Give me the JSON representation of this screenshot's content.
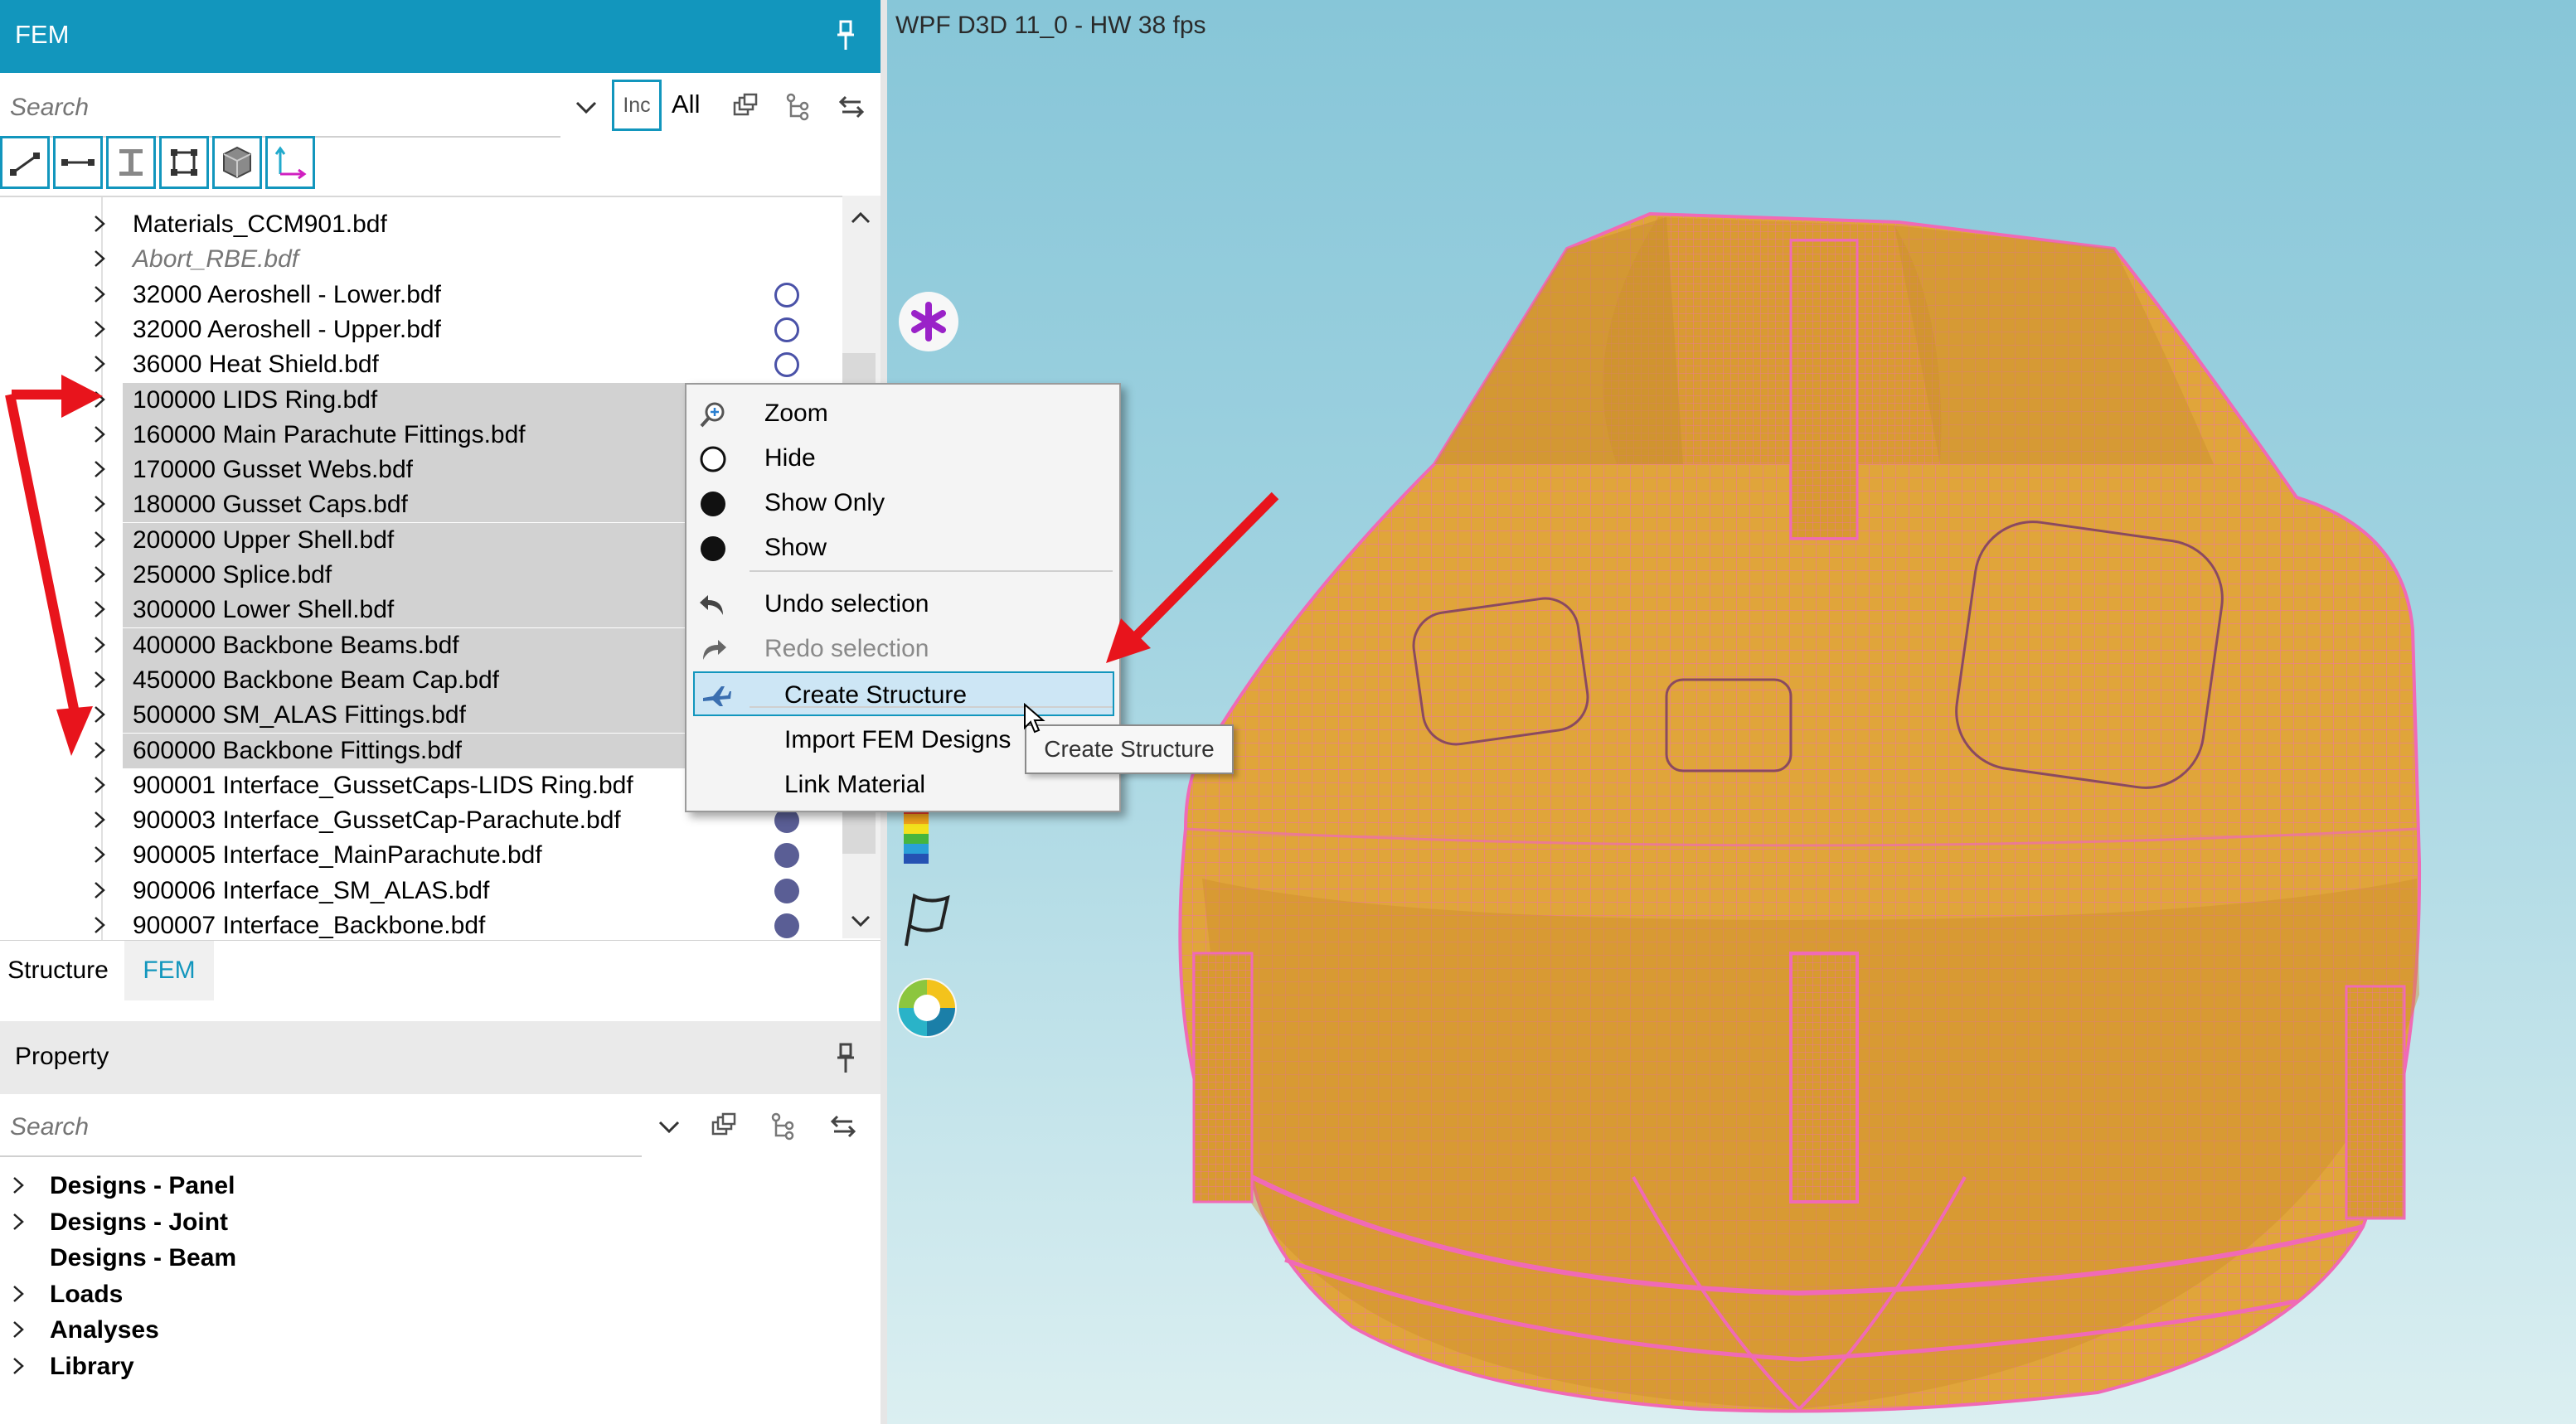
{
  "fem_panel": {
    "title": "FEM",
    "search": {
      "placeholder": "Search",
      "inc_label": "Inc",
      "all_label": "All"
    },
    "tree_items": [
      {
        "label": "Materials_CCM901.bdf",
        "italic": false,
        "selected": false,
        "indicator": "none"
      },
      {
        "label": "Abort_RBE.bdf",
        "italic": true,
        "selected": false,
        "indicator": "none"
      },
      {
        "label": "32000 Aeroshell - Lower.bdf",
        "italic": false,
        "selected": false,
        "indicator": "empty"
      },
      {
        "label": "32000 Aeroshell - Upper.bdf",
        "italic": false,
        "selected": false,
        "indicator": "empty"
      },
      {
        "label": "36000 Heat Shield.bdf",
        "italic": false,
        "selected": false,
        "indicator": "empty"
      },
      {
        "label": "100000 LIDS Ring.bdf",
        "italic": false,
        "selected": true,
        "indicator": "none"
      },
      {
        "label": "160000 Main Parachute Fittings.bdf",
        "italic": false,
        "selected": true,
        "indicator": "none"
      },
      {
        "label": "170000 Gusset Webs.bdf",
        "italic": false,
        "selected": true,
        "indicator": "none"
      },
      {
        "label": "180000 Gusset Caps.bdf",
        "italic": false,
        "selected": true,
        "indicator": "none"
      },
      {
        "label": "200000 Upper Shell.bdf",
        "italic": false,
        "selected": true,
        "indicator": "none"
      },
      {
        "label": "250000 Splice.bdf",
        "italic": false,
        "selected": true,
        "indicator": "none"
      },
      {
        "label": "300000 Lower Shell.bdf",
        "italic": false,
        "selected": true,
        "indicator": "none"
      },
      {
        "label": "400000 Backbone Beams.bdf",
        "italic": false,
        "selected": true,
        "indicator": "none"
      },
      {
        "label": "450000 Backbone Beam Cap.bdf",
        "italic": false,
        "selected": true,
        "indicator": "none"
      },
      {
        "label": "500000 SM_ALAS Fittings.bdf",
        "italic": false,
        "selected": true,
        "indicator": "none"
      },
      {
        "label": "600000 Backbone Fittings.bdf",
        "italic": false,
        "selected": true,
        "indicator": "none"
      },
      {
        "label": "900001 Interface_GussetCaps-LIDS Ring.bdf",
        "italic": false,
        "selected": false,
        "indicator": "full"
      },
      {
        "label": "900003 Interface_GussetCap-Parachute.bdf",
        "italic": false,
        "selected": false,
        "indicator": "full"
      },
      {
        "label": "900005 Interface_MainParachute.bdf",
        "italic": false,
        "selected": false,
        "indicator": "full"
      },
      {
        "label": "900006 Interface_SM_ALAS.bdf",
        "italic": false,
        "selected": false,
        "indicator": "full"
      },
      {
        "label": "900007 Interface_Backbone.bdf",
        "italic": false,
        "selected": false,
        "indicator": "full"
      }
    ],
    "tabs": [
      {
        "label": "Structure",
        "active": false
      },
      {
        "label": "FEM",
        "active": true
      }
    ]
  },
  "property_panel": {
    "title": "Property",
    "search": {
      "placeholder": "Search"
    },
    "items": [
      {
        "label": "Designs - Panel",
        "expandable": true
      },
      {
        "label": "Designs - Joint",
        "expandable": true
      },
      {
        "label": "Designs - Beam",
        "expandable": false
      },
      {
        "label": "Loads",
        "expandable": true
      },
      {
        "label": "Analyses",
        "expandable": true
      },
      {
        "label": "Library",
        "expandable": true
      }
    ]
  },
  "viewport": {
    "title": "WPF D3D 11_0 - HW  38  fps",
    "colors": {
      "model_fill": "#e0a53a",
      "mesh_lines": "#f06ab6",
      "accent": "#1296bd",
      "arrow": "#e8141c"
    }
  },
  "context_menu": {
    "items": [
      {
        "label": "Zoom",
        "icon": "zoom-icon",
        "disabled": false,
        "highlighted": false
      },
      {
        "label": "Hide",
        "icon": "hide-circle-icon",
        "disabled": false,
        "highlighted": false
      },
      {
        "label": "Show Only",
        "icon": "show-only-circle-icon",
        "disabled": false,
        "highlighted": false
      },
      {
        "label": "Show",
        "icon": "show-circle-icon",
        "disabled": false,
        "highlighted": false
      },
      {
        "label": "Undo selection",
        "icon": "undo-icon",
        "disabled": false,
        "highlighted": false
      },
      {
        "label": "Redo selection",
        "icon": "redo-icon",
        "disabled": true,
        "highlighted": false
      },
      {
        "label": "Create Structure",
        "icon": "create-structure-icon",
        "disabled": false,
        "highlighted": true
      },
      {
        "label": "Import FEM Designs",
        "icon": "",
        "disabled": false,
        "highlighted": false
      },
      {
        "label": "Link Material",
        "icon": "",
        "disabled": false,
        "highlighted": false
      }
    ],
    "tooltip": "Create Structure"
  }
}
